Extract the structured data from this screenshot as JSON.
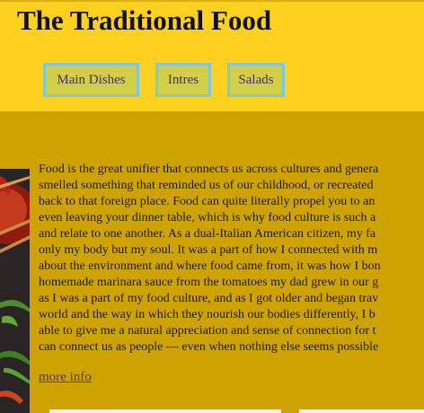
{
  "header": {
    "title": "The Traditional Food"
  },
  "nav": {
    "items": [
      {
        "label": "Main Dishes"
      },
      {
        "label": "Intres"
      },
      {
        "label": "Salads"
      }
    ]
  },
  "article": {
    "lines": [
      "Food is the great unifier that connects us across cultures and genera",
      "smelled something that reminded us of our childhood, or recreated",
      "back to that foreign place. Food can quite literally propel you to an",
      "even leaving your dinner table, which is why food culture is such a",
      "and relate to one another. As a dual-Italian American citizen, my fa",
      "only my body but my soul. It was a part of how I connected with m",
      "about the environment and where food came from, it was how I bon",
      "homemade marinara sauce from the tomatoes my dad grew in our g",
      "as I was a part of my food culture, and as I got older and began trav",
      "world and the way in which they nourish our bodies differently, I b",
      "able to give me a natural appreciation and sense of connection for t",
      "can connect us as people — even when nothing else seems possible"
    ],
    "link": "more info"
  },
  "image": {
    "icon": "food-photo-chilies-chopsticks"
  },
  "colors": {
    "header_bg": "#fed01f",
    "page_bg": "#cea200",
    "nav_button_bg": "#d1ce47",
    "nav_button_border": "#7ec7dc",
    "nav_button_text": "#4f2a6f",
    "link": "#5b2a7a"
  }
}
